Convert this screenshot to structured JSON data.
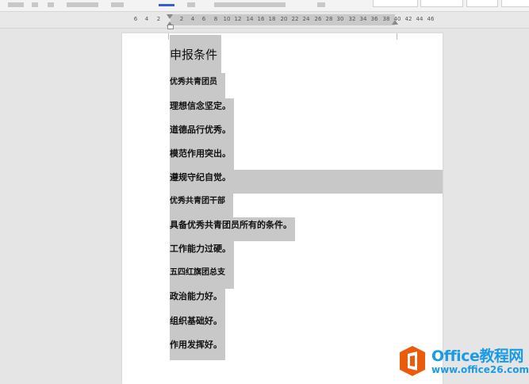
{
  "ruler": {
    "ticks": [
      "6",
      "4",
      "2",
      "2",
      "4",
      "6",
      "8",
      "10",
      "12",
      "14",
      "16",
      "18",
      "20",
      "22",
      "24",
      "26",
      "28",
      "30",
      "32",
      "34",
      "36",
      "38",
      "40",
      "42",
      "44",
      "46"
    ]
  },
  "document": {
    "title": "申报条件",
    "lines": [
      "优秀共青团员",
      "理想信念坚定。",
      "道德品行优秀。",
      "模范作用突出。",
      "遵规守纪自觉。",
      "优秀共青团干部",
      "具备优秀共青团员所有的条件。",
      "工作能力过硬。",
      "五四红旗团总支",
      "政治能力好。",
      "组织基础好。",
      "作用发挥好。"
    ]
  },
  "watermark": {
    "brand": "Office教程网",
    "url": "www.office26.com",
    "logo_icon": "office-logo-icon"
  },
  "colors": {
    "highlight": "#c8c8c8",
    "brand": "#1a9be6",
    "logo_orange": "#ea5b0c"
  }
}
